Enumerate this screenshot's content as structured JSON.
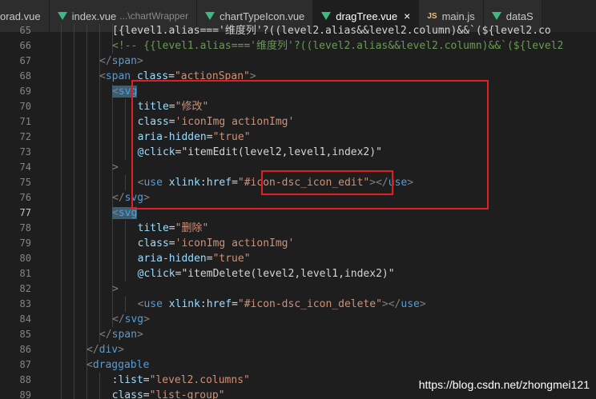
{
  "tabs": [
    {
      "label": "orad.vue",
      "icon": "vue-icon"
    },
    {
      "label": "index.vue",
      "desc": "...\\chartWrapper",
      "icon": "vue-icon"
    },
    {
      "label": "chartTypeIcon.vue",
      "icon": "vue-icon"
    },
    {
      "label": "dragTree.vue",
      "icon": "vue-icon",
      "active": true,
      "close": "×"
    },
    {
      "label": "main.js",
      "icon": "js-icon"
    },
    {
      "label": "dataS",
      "icon": "vue-icon"
    }
  ],
  "js_icon_text": "JS",
  "current_line": 77,
  "lines": [
    {
      "n": "65",
      "tokens": [
        {
          "t": "[{level1.alias==='维度列'?((level2.alias&&level2.column)&&`(${level2.co",
          "c": "t-txt"
        }
      ]
    },
    {
      "n": "66",
      "tokens": [
        {
          "t": "<!-- {{level1.alias==='维度列'?((level2.alias&&level2.column)&&`(${level2",
          "c": "t-cmt"
        }
      ]
    },
    {
      "n": "67",
      "tokens": [
        {
          "t": "</",
          "c": "t-pun"
        },
        {
          "t": "span",
          "c": "t-tag"
        },
        {
          "t": ">",
          "c": "t-pun"
        }
      ]
    },
    {
      "n": "68",
      "tokens": [
        {
          "t": "<",
          "c": "t-pun"
        },
        {
          "t": "span",
          "c": "t-tag"
        },
        {
          "t": " class",
          "c": "t-attr"
        },
        {
          "t": "=",
          "c": "t-txt"
        },
        {
          "t": "\"actionSpan\"",
          "c": "t-str"
        },
        {
          "t": ">",
          "c": "t-pun"
        }
      ]
    },
    {
      "n": "69",
      "tokens": [
        {
          "t": "<",
          "c": "t-pun t-hl"
        },
        {
          "t": "svg",
          "c": "t-tag t-hl"
        }
      ]
    },
    {
      "n": "70",
      "tokens": [
        {
          "t": "  title",
          "c": "t-attr"
        },
        {
          "t": "=",
          "c": "t-txt"
        },
        {
          "t": "\"修改\"",
          "c": "t-str"
        }
      ]
    },
    {
      "n": "71",
      "tokens": [
        {
          "t": "  class",
          "c": "t-attr"
        },
        {
          "t": "=",
          "c": "t-txt"
        },
        {
          "t": "'iconImg actionImg'",
          "c": "t-str"
        }
      ]
    },
    {
      "n": "72",
      "tokens": [
        {
          "t": "  aria-hidden",
          "c": "t-attr"
        },
        {
          "t": "=",
          "c": "t-txt"
        },
        {
          "t": "\"true\"",
          "c": "t-str"
        }
      ]
    },
    {
      "n": "73",
      "tokens": [
        {
          "t": "  @click",
          "c": "t-attr"
        },
        {
          "t": "=",
          "c": "t-txt"
        },
        {
          "t": "\"itemEdit(level2,level1,index2)\"",
          "c": "t-txt"
        }
      ]
    },
    {
      "n": "74",
      "tokens": [
        {
          "t": ">",
          "c": "t-pun"
        }
      ]
    },
    {
      "n": "75",
      "tokens": [
        {
          "t": "  <",
          "c": "t-pun"
        },
        {
          "t": "use",
          "c": "t-tag"
        },
        {
          "t": " xlink:href",
          "c": "t-attr"
        },
        {
          "t": "=",
          "c": "t-txt"
        },
        {
          "t": "\"#icon-dsc_icon_edit\"",
          "c": "t-str"
        },
        {
          "t": "></",
          "c": "t-pun"
        },
        {
          "t": "use",
          "c": "t-tag"
        },
        {
          "t": ">",
          "c": "t-pun"
        }
      ]
    },
    {
      "n": "76",
      "tokens": [
        {
          "t": "</",
          "c": "t-pun"
        },
        {
          "t": "svg",
          "c": "t-tag"
        },
        {
          "t": ">",
          "c": "t-pun"
        }
      ]
    },
    {
      "n": "77",
      "tokens": [
        {
          "t": "<",
          "c": "t-pun t-hl"
        },
        {
          "t": "svg",
          "c": "t-tag t-hl"
        }
      ]
    },
    {
      "n": "78",
      "tokens": [
        {
          "t": "  title",
          "c": "t-attr"
        },
        {
          "t": "=",
          "c": "t-txt"
        },
        {
          "t": "\"删除\"",
          "c": "t-str"
        }
      ]
    },
    {
      "n": "79",
      "tokens": [
        {
          "t": "  class",
          "c": "t-attr"
        },
        {
          "t": "=",
          "c": "t-txt"
        },
        {
          "t": "'iconImg actionImg'",
          "c": "t-str"
        }
      ]
    },
    {
      "n": "80",
      "tokens": [
        {
          "t": "  aria-hidden",
          "c": "t-attr"
        },
        {
          "t": "=",
          "c": "t-txt"
        },
        {
          "t": "\"true\"",
          "c": "t-str"
        }
      ]
    },
    {
      "n": "81",
      "tokens": [
        {
          "t": "  @click",
          "c": "t-attr"
        },
        {
          "t": "=",
          "c": "t-txt"
        },
        {
          "t": "\"itemDelete(level2,level1,index2)\"",
          "c": "t-txt"
        }
      ]
    },
    {
      "n": "82",
      "tokens": [
        {
          "t": ">",
          "c": "t-pun"
        }
      ]
    },
    {
      "n": "83",
      "tokens": [
        {
          "t": "  <",
          "c": "t-pun"
        },
        {
          "t": "use",
          "c": "t-tag"
        },
        {
          "t": " xlink:href",
          "c": "t-attr"
        },
        {
          "t": "=",
          "c": "t-txt"
        },
        {
          "t": "\"#icon-dsc_icon_delete\"",
          "c": "t-str"
        },
        {
          "t": "></",
          "c": "t-pun"
        },
        {
          "t": "use",
          "c": "t-tag"
        },
        {
          "t": ">",
          "c": "t-pun"
        }
      ]
    },
    {
      "n": "84",
      "tokens": [
        {
          "t": "</",
          "c": "t-pun"
        },
        {
          "t": "svg",
          "c": "t-tag"
        },
        {
          "t": ">",
          "c": "t-pun"
        }
      ]
    },
    {
      "n": "85",
      "tokens": [
        {
          "t": "</",
          "c": "t-pun"
        },
        {
          "t": "span",
          "c": "t-tag"
        },
        {
          "t": ">",
          "c": "t-pun"
        }
      ]
    },
    {
      "n": "86",
      "tokens": [
        {
          "t": "</",
          "c": "t-pun"
        },
        {
          "t": "div",
          "c": "t-tag"
        },
        {
          "t": ">",
          "c": "t-pun"
        }
      ]
    },
    {
      "n": "87",
      "tokens": [
        {
          "t": "<",
          "c": "t-pun"
        },
        {
          "t": "draggable",
          "c": "t-tag"
        }
      ]
    },
    {
      "n": "88",
      "tokens": [
        {
          "t": "  :list",
          "c": "t-attr"
        },
        {
          "t": "=",
          "c": "t-txt"
        },
        {
          "t": "\"level2.columns\"",
          "c": "t-str"
        }
      ]
    },
    {
      "n": "89",
      "tokens": [
        {
          "t": "  class",
          "c": "t-attr"
        },
        {
          "t": "=",
          "c": "t-txt"
        },
        {
          "t": "\"list-group\"",
          "c": "t-str"
        }
      ]
    }
  ],
  "watermark": "https://blog.csdn.net/zhongmei121",
  "colors": {
    "highlight_box": "#e02020",
    "background": "#1e1e1e"
  }
}
